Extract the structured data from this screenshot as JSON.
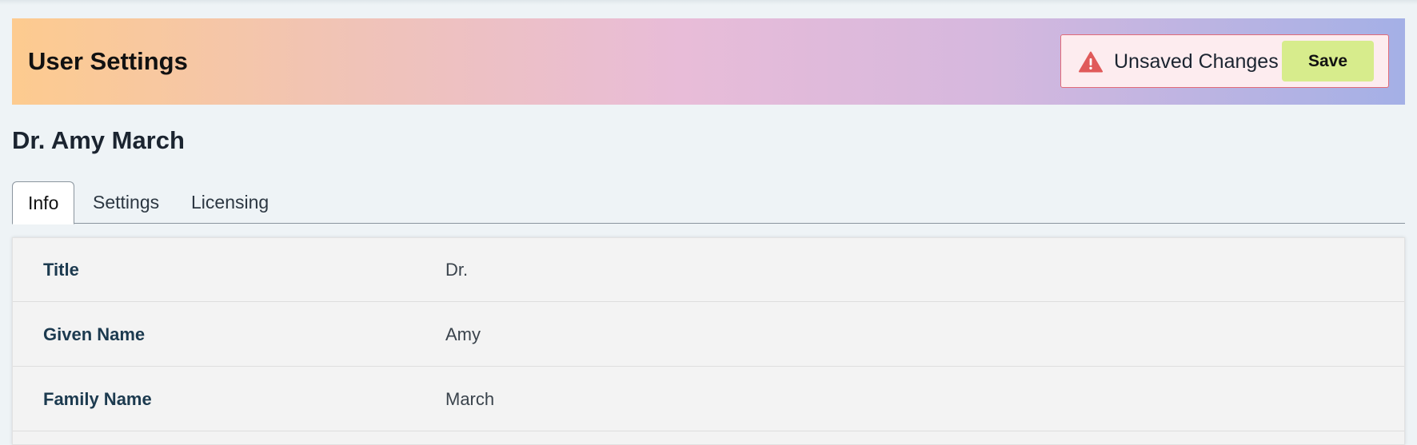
{
  "header": {
    "title": "User Settings",
    "unsaved_text": "Unsaved Changes",
    "save_label": "Save",
    "warning_icon": "warning-triangle-icon",
    "warning_color": "#e05a5a",
    "save_color": "#d7ec8c"
  },
  "user": {
    "name": "Dr. Amy March"
  },
  "tabs": [
    {
      "label": "Info",
      "active": true
    },
    {
      "label": "Settings",
      "active": false
    },
    {
      "label": "Licensing",
      "active": false
    }
  ],
  "info_rows": [
    {
      "label": "Title",
      "value": "Dr."
    },
    {
      "label": "Given Name",
      "value": "Amy"
    },
    {
      "label": "Family Name",
      "value": "March"
    }
  ]
}
